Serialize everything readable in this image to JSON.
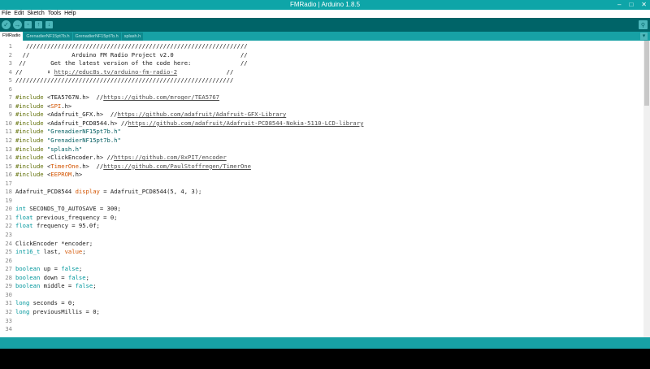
{
  "window": {
    "title": "FMRadio | Arduino 1.8.5",
    "controls": [
      "–",
      "□",
      "✕"
    ]
  },
  "menu": [
    "File",
    "Edit",
    "Sketch",
    "Tools",
    "Help"
  ],
  "toolbar": {
    "buttons": [
      {
        "name": "verify-button",
        "glyph": "✓"
      },
      {
        "name": "upload-button",
        "glyph": "→"
      },
      {
        "name": "new-button",
        "glyph": "▫"
      },
      {
        "name": "open-button",
        "glyph": "↑"
      },
      {
        "name": "save-button",
        "glyph": "↓"
      }
    ],
    "serial_glyph": "⚲"
  },
  "tabs": [
    {
      "label": "FMRadio",
      "active": true
    },
    {
      "label": "GrenadierNF15pt7b.h",
      "active": false
    },
    {
      "label": "GrenadierNF15pt7b.h",
      "active": false
    },
    {
      "label": "splash.h",
      "active": false
    }
  ],
  "tab_menu_glyph": "▾",
  "code_lines": [
    {
      "n": "1",
      "tokens": [
        {
          "t": "   ///////////////////////////////////////////////////////////////"
        }
      ]
    },
    {
      "n": "2",
      "tokens": [
        {
          "t": "  //            Arduino FM Radio Project v2.0                   //"
        }
      ]
    },
    {
      "n": "3",
      "tokens": [
        {
          "t": " //       Get the latest version of the code here:              //"
        }
      ]
    },
    {
      "n": "4",
      "tokens": [
        {
          "t": "//       ⬇ "
        },
        {
          "t": "http://educ8s.tv/arduino-fm-radio-2",
          "c": "t-link"
        },
        {
          "t": "              //"
        }
      ]
    },
    {
      "n": "5",
      "tokens": [
        {
          "t": "//////////////////////////////////////////////////////////////"
        }
      ]
    },
    {
      "n": "6",
      "tokens": [
        {
          "t": ""
        }
      ]
    },
    {
      "n": "7",
      "tokens": [
        {
          "t": "#include",
          "c": "t-kw"
        },
        {
          "t": " <TEA5767N.h>  //"
        },
        {
          "t": "https://github.com/mroger/TEA5767",
          "c": "t-link"
        }
      ]
    },
    {
      "n": "8",
      "tokens": [
        {
          "t": "#include",
          "c": "t-kw"
        },
        {
          "t": " <"
        },
        {
          "t": "SPI",
          "c": "t-lib"
        },
        {
          "t": ".h>"
        }
      ]
    },
    {
      "n": "9",
      "tokens": [
        {
          "t": "#include",
          "c": "t-kw"
        },
        {
          "t": " <Adafruit_GFX.h>  //"
        },
        {
          "t": "https://github.com/adafruit/Adafruit-GFX-Library",
          "c": "t-link"
        }
      ]
    },
    {
      "n": "10",
      "tokens": [
        {
          "t": "#include",
          "c": "t-kw"
        },
        {
          "t": " <Adafruit_PCD8544.h> //"
        },
        {
          "t": "https://github.com/adafruit/Adafruit-PCD8544-Nokia-5110-LCD-library",
          "c": "t-link"
        }
      ]
    },
    {
      "n": "11",
      "tokens": [
        {
          "t": "#include",
          "c": "t-kw"
        },
        {
          "t": " "
        },
        {
          "t": "\"GrenadierNF15pt7b.h\"",
          "c": "t-str"
        }
      ]
    },
    {
      "n": "12",
      "tokens": [
        {
          "t": "#include",
          "c": "t-kw"
        },
        {
          "t": " "
        },
        {
          "t": "\"GrenadierNF15pt7b.h\"",
          "c": "t-str"
        }
      ]
    },
    {
      "n": "13",
      "tokens": [
        {
          "t": "#include",
          "c": "t-kw"
        },
        {
          "t": " "
        },
        {
          "t": "\"splash.h\"",
          "c": "t-str"
        }
      ]
    },
    {
      "n": "14",
      "tokens": [
        {
          "t": "#include",
          "c": "t-kw"
        },
        {
          "t": " <ClickEncoder.h> //"
        },
        {
          "t": "https://github.com/0xPIT/encoder",
          "c": "t-link"
        }
      ]
    },
    {
      "n": "15",
      "tokens": [
        {
          "t": "#include",
          "c": "t-kw"
        },
        {
          "t": " <"
        },
        {
          "t": "TimerOne",
          "c": "t-lib"
        },
        {
          "t": ".h>  //"
        },
        {
          "t": "https://github.com/PaulStoffregen/TimerOne",
          "c": "t-link"
        }
      ]
    },
    {
      "n": "16",
      "tokens": [
        {
          "t": "#include",
          "c": "t-kw"
        },
        {
          "t": " <"
        },
        {
          "t": "EEPROM",
          "c": "t-lib"
        },
        {
          "t": ".h>"
        }
      ]
    },
    {
      "n": "17",
      "tokens": [
        {
          "t": ""
        }
      ]
    },
    {
      "n": "18",
      "tokens": [
        {
          "t": "Adafruit_PCD8544 "
        },
        {
          "t": "display",
          "c": "t-lib"
        },
        {
          "t": " = Adafruit_PCD8544(5, 4, 3);"
        }
      ]
    },
    {
      "n": "19",
      "tokens": [
        {
          "t": ""
        }
      ]
    },
    {
      "n": "20",
      "tokens": [
        {
          "t": "int",
          "c": "t-type"
        },
        {
          "t": " SECONDS_TO_AUTOSAVE = 300;"
        }
      ]
    },
    {
      "n": "21",
      "tokens": [
        {
          "t": "float",
          "c": "t-type"
        },
        {
          "t": " previous_frequency = 0;"
        }
      ]
    },
    {
      "n": "22",
      "tokens": [
        {
          "t": "float",
          "c": "t-type"
        },
        {
          "t": " frequency = 95.0f;"
        }
      ]
    },
    {
      "n": "23",
      "tokens": [
        {
          "t": ""
        }
      ]
    },
    {
      "n": "24",
      "tokens": [
        {
          "t": "ClickEncoder *encoder;"
        }
      ]
    },
    {
      "n": "25",
      "tokens": [
        {
          "t": "int16_t",
          "c": "t-type"
        },
        {
          "t": " last, "
        },
        {
          "t": "value",
          "c": "t-lib"
        },
        {
          "t": ";"
        }
      ]
    },
    {
      "n": "26",
      "tokens": [
        {
          "t": ""
        }
      ]
    },
    {
      "n": "27",
      "tokens": [
        {
          "t": "boolean",
          "c": "t-type"
        },
        {
          "t": " up = "
        },
        {
          "t": "false",
          "c": "t-type"
        },
        {
          "t": ";"
        }
      ]
    },
    {
      "n": "28",
      "tokens": [
        {
          "t": "boolean",
          "c": "t-type"
        },
        {
          "t": " down = "
        },
        {
          "t": "false",
          "c": "t-type"
        },
        {
          "t": ";"
        }
      ]
    },
    {
      "n": "29",
      "tokens": [
        {
          "t": "boolean",
          "c": "t-type"
        },
        {
          "t": " middle = "
        },
        {
          "t": "false",
          "c": "t-type"
        },
        {
          "t": ";"
        }
      ]
    },
    {
      "n": "30",
      "tokens": [
        {
          "t": ""
        }
      ]
    },
    {
      "n": "31",
      "tokens": [
        {
          "t": "long",
          "c": "t-type"
        },
        {
          "t": " seconds = 0;"
        }
      ]
    },
    {
      "n": "32",
      "tokens": [
        {
          "t": "long",
          "c": "t-type"
        },
        {
          "t": " previousMillis = 0;"
        }
      ]
    },
    {
      "n": "33",
      "tokens": [
        {
          "t": ""
        }
      ]
    },
    {
      "n": "34",
      "tokens": [
        {
          "t": ""
        }
      ]
    }
  ],
  "colors": {
    "titlebar": "#0ea5a8",
    "toolbar": "#006468",
    "tabbar": "#17a1a5",
    "statusbar": "#17a1a5",
    "console": "#000000"
  }
}
